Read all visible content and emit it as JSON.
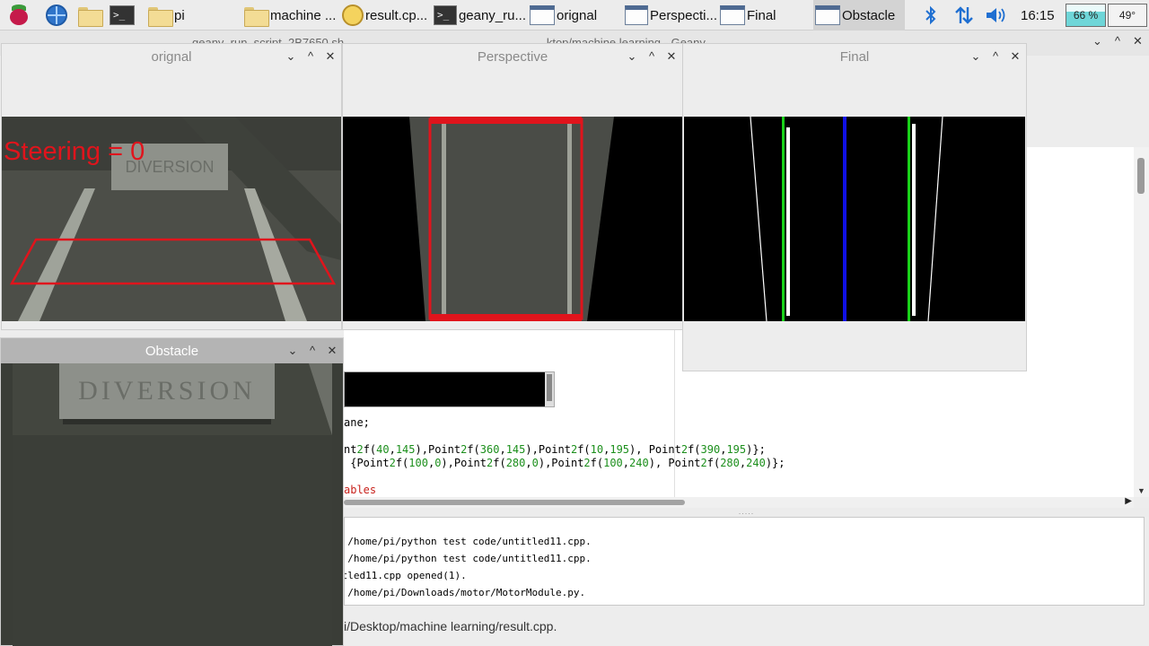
{
  "taskbar": {
    "tasks": [
      {
        "label": "pi",
        "icon": "folder-icon"
      },
      {
        "label": "machine ...",
        "icon": "folder-icon"
      },
      {
        "label": "result.cp...",
        "icon": "geany-icon"
      },
      {
        "label": "geany_ru...",
        "icon": "terminal-icon"
      },
      {
        "label": "orignal",
        "icon": "window-icon"
      },
      {
        "label": "Perspecti...",
        "icon": "window-icon"
      },
      {
        "label": "Final",
        "icon": "window-icon"
      },
      {
        "label": "Obstacle",
        "icon": "window-icon"
      }
    ],
    "clock": "16:15",
    "cpu": "66 %",
    "cpu_level": 0.66,
    "temperature": "49°"
  },
  "geany": {
    "title_fragment_left": "geany_run_script_2B7650.sh",
    "title_fragment_right": "...ktop/machine learning - Geany",
    "code_lines": [
      {
        "text": "ane;"
      },
      {
        "text": "nt2f(40,145),Point2f(360,145),Point2f(10,195), Point2f(390,195)};"
      },
      {
        "text": " {Point2f(100,0),Point2f(280,0),Point2f(100,240), Point2f(280,240)};"
      },
      {
        "text": "ables"
      }
    ],
    "messages": [
      "r /home/pi/python test code/untitled11.cpp.",
      "r /home/pi/python test code/untitled11.cpp.",
      "itled11.cpp opened(1).",
      "r /home/pi/Downloads/motor/MotorModule.py."
    ],
    "status_path": "i/Desktop/machine learning/result.cpp."
  },
  "windows": {
    "orignal": {
      "title": "orignal",
      "overlay_text": "Steering = 0",
      "sign_text": "DIVERSION"
    },
    "perspective": {
      "title": "Perspective"
    },
    "final": {
      "title": "Final"
    },
    "obstacle": {
      "title": "Obstacle",
      "sign_text": "DIVERSION"
    }
  },
  "window_controls": {
    "minimize": "⌄",
    "maximize": "^",
    "close": "✕"
  },
  "colors": {
    "roi_red": "#e0141c",
    "lane_green": "#19d219",
    "center_blue": "#1010e6"
  }
}
